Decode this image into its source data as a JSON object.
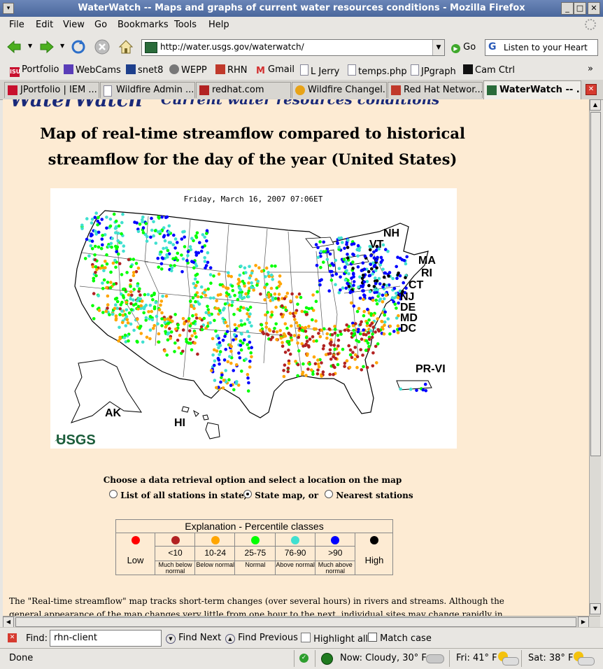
{
  "window": {
    "title": "WaterWatch -- Maps and graphs of current water resources conditions - Mozilla Firefox"
  },
  "menu": [
    "File",
    "Edit",
    "View",
    "Go",
    "Bookmarks",
    "Tools",
    "Help"
  ],
  "nav": {
    "url": "http://water.usgs.gov/waterwatch/",
    "go_label": "Go",
    "search_value": "Listen to your Heart"
  },
  "bookmarks": [
    "Portfolio",
    "WebCams",
    "snet8",
    "WEPP",
    "RHN",
    "Gmail",
    "L Jerry",
    "temps.php",
    "JPgraph",
    "Cam Ctrl"
  ],
  "tabs": [
    "JPortfolio | IEM ...",
    "Wildfire Admin ...",
    "redhat.com",
    "Wildfire Changel...",
    "Red Hat Networ...",
    "WaterWatch -- ..."
  ],
  "page": {
    "banner_left": "WaterWatch",
    "banner_right": "Current water resources conditions",
    "heading_line1": "Map of real-time streamflow compared to historical",
    "heading_line2": "streamflow for the day of the year (United States)",
    "map_timestamp": "Friday, March 16, 2007 07:06ET",
    "map_labels": {
      "nh": "NH",
      "vt": "VT",
      "ma": "MA",
      "ri": "RI",
      "ct": "CT",
      "nj": "NJ",
      "de": "DE",
      "md": "MD",
      "dc": "DC",
      "prvi": "PR-VI",
      "ak": "AK",
      "hi": "HI",
      "usgs": "USGS"
    },
    "choose_text": "Choose a data retrieval option and select a location on the map",
    "radio1": "List of all stations in state,",
    "radio2": "State map, or",
    "radio3": "Nearest stations",
    "legend": {
      "title": "Explanation - Percentile classes",
      "low": "Low",
      "high": "High",
      "classes": [
        {
          "range": "<10",
          "desc": "Much below normal",
          "color": "#b22222"
        },
        {
          "range": "10-24",
          "desc": "Below normal",
          "color": "#ffa500"
        },
        {
          "range": "25-75",
          "desc": "Normal",
          "color": "#00ff00"
        },
        {
          "range": "76-90",
          "desc": "Above normal",
          "color": "#40e0d0"
        },
        {
          "range": ">90",
          "desc": "Much above normal",
          "color": "#0000ff"
        }
      ],
      "low_color": "#ff0000",
      "high_color": "#000000"
    },
    "paragraph": "The \"Real-time streamflow\" map tracks short-term changes (over several hours) in rivers and streams. Although the",
    "paragraph2": "general appearance of the map changes very little from one hour to the next, individual sites may change rapidly in"
  },
  "find": {
    "label": "Find:",
    "value": "rhn-client",
    "next": "Find Next",
    "previous": "Find Previous",
    "highlight": "Highlight all",
    "match": "Match case"
  },
  "status": {
    "text": "Done",
    "now": "Now: Cloudy, 30° F",
    "fri": "Fri: 41° F",
    "sat": "Sat: 38° F"
  }
}
